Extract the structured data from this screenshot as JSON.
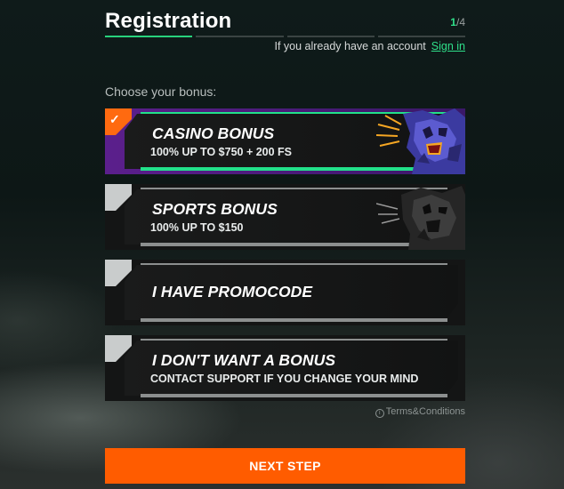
{
  "header": {
    "title": "Registration",
    "step_current": "1",
    "step_total": "/4"
  },
  "account": {
    "prompt": "If you already have an account",
    "sign_in_label": "Sign in"
  },
  "choose_label": "Choose your bonus:",
  "bonuses": [
    {
      "title": "CASINO BONUS",
      "subtitle": "100% UP TO $750 + 200 FS",
      "selected": true,
      "art": "purple-tiger"
    },
    {
      "title": "SPORTS BONUS",
      "subtitle": "100% UP TO $150",
      "selected": false,
      "art": "dark-tiger"
    },
    {
      "title": "I HAVE PROMOCODE",
      "subtitle": "",
      "selected": false
    },
    {
      "title": "I DON'T WANT A BONUS",
      "subtitle": "CONTACT SUPPORT IF YOU CHANGE YOUR MIND",
      "selected": false
    }
  ],
  "check_glyph": "✓",
  "terms": {
    "icon": "info-icon",
    "label": "Terms&Conditions"
  },
  "next_label": "NEXT STEP",
  "colors": {
    "accent_green": "#28d17c",
    "accent_orange": "#ff5c00",
    "selected_purple": "#5b1f8c"
  }
}
